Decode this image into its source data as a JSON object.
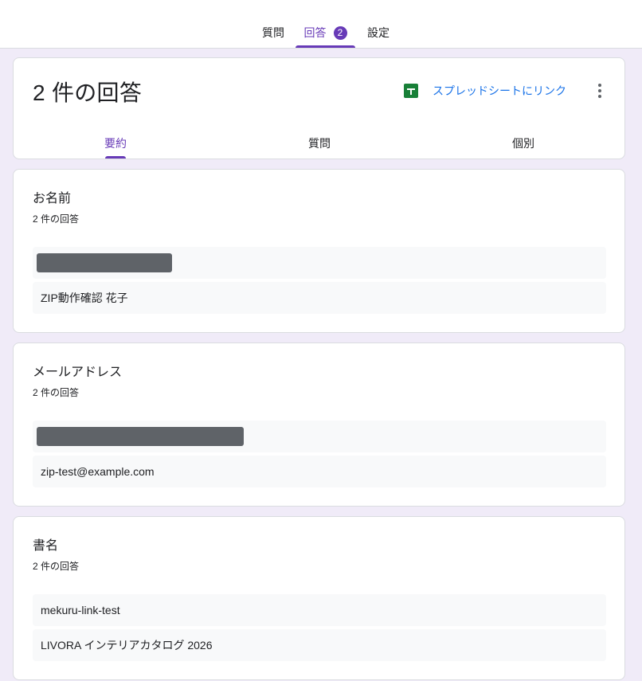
{
  "topnav": {
    "tabs": [
      {
        "label": "質問"
      },
      {
        "label": "回答",
        "badge": "2",
        "active": true
      },
      {
        "label": "設定"
      }
    ]
  },
  "summary": {
    "title": "2 件の回答",
    "sheets_link_label": "スプレッドシートにリンク",
    "subtabs": [
      {
        "label": "要約",
        "active": true
      },
      {
        "label": "質問"
      },
      {
        "label": "個別"
      }
    ]
  },
  "questions": [
    {
      "title": "お名前",
      "count": "2 件の回答",
      "answers": [
        "ZIP動作確認 花子"
      ]
    },
    {
      "title": "メールアドレス",
      "count": "2 件の回答",
      "answers": [
        "zip-test@example.com"
      ]
    },
    {
      "title": "書名",
      "count": "2 件の回答",
      "answers": [
        "mekuru-link-test",
        "LIVORA インテリアカタログ 2026"
      ]
    }
  ],
  "colors": {
    "accent": "#673ab7",
    "link": "#1a73e8",
    "sheets_green": "#188038",
    "background": "#f0ebf8",
    "redaction": "#5f6368"
  }
}
